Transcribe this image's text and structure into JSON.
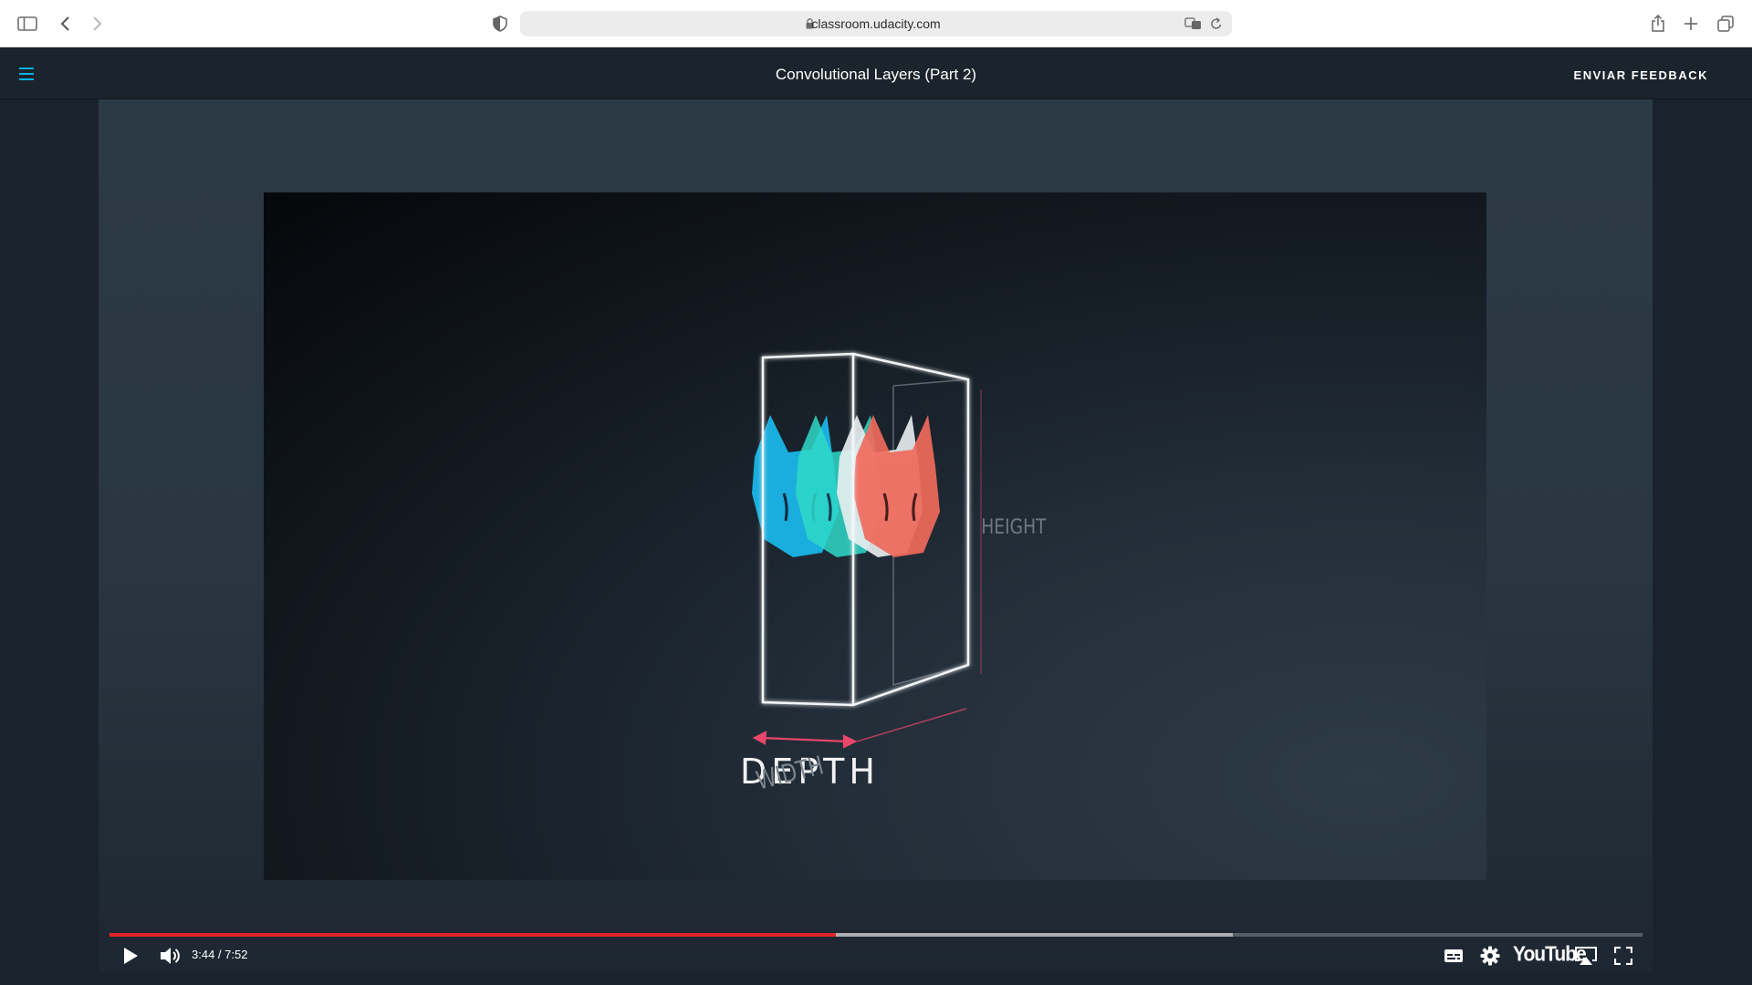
{
  "browser": {
    "url": "classroom.udacity.com"
  },
  "header": {
    "title": "Convolutional Layers (Part 2)",
    "feedback_label": "ENVIAR FEEDBACK",
    "accent_color": "#02b3e4"
  },
  "video": {
    "labels": {
      "depth": "DEPTH",
      "width": "WIDTH",
      "height": "HEIGHT"
    },
    "time_display": "3:44 / 7:52",
    "current_time": "3:44",
    "duration": "7:52",
    "progress_played": 0.474,
    "progress_buffered": 0.733,
    "brand": "YouTube",
    "progress_color": "#e1242b"
  }
}
